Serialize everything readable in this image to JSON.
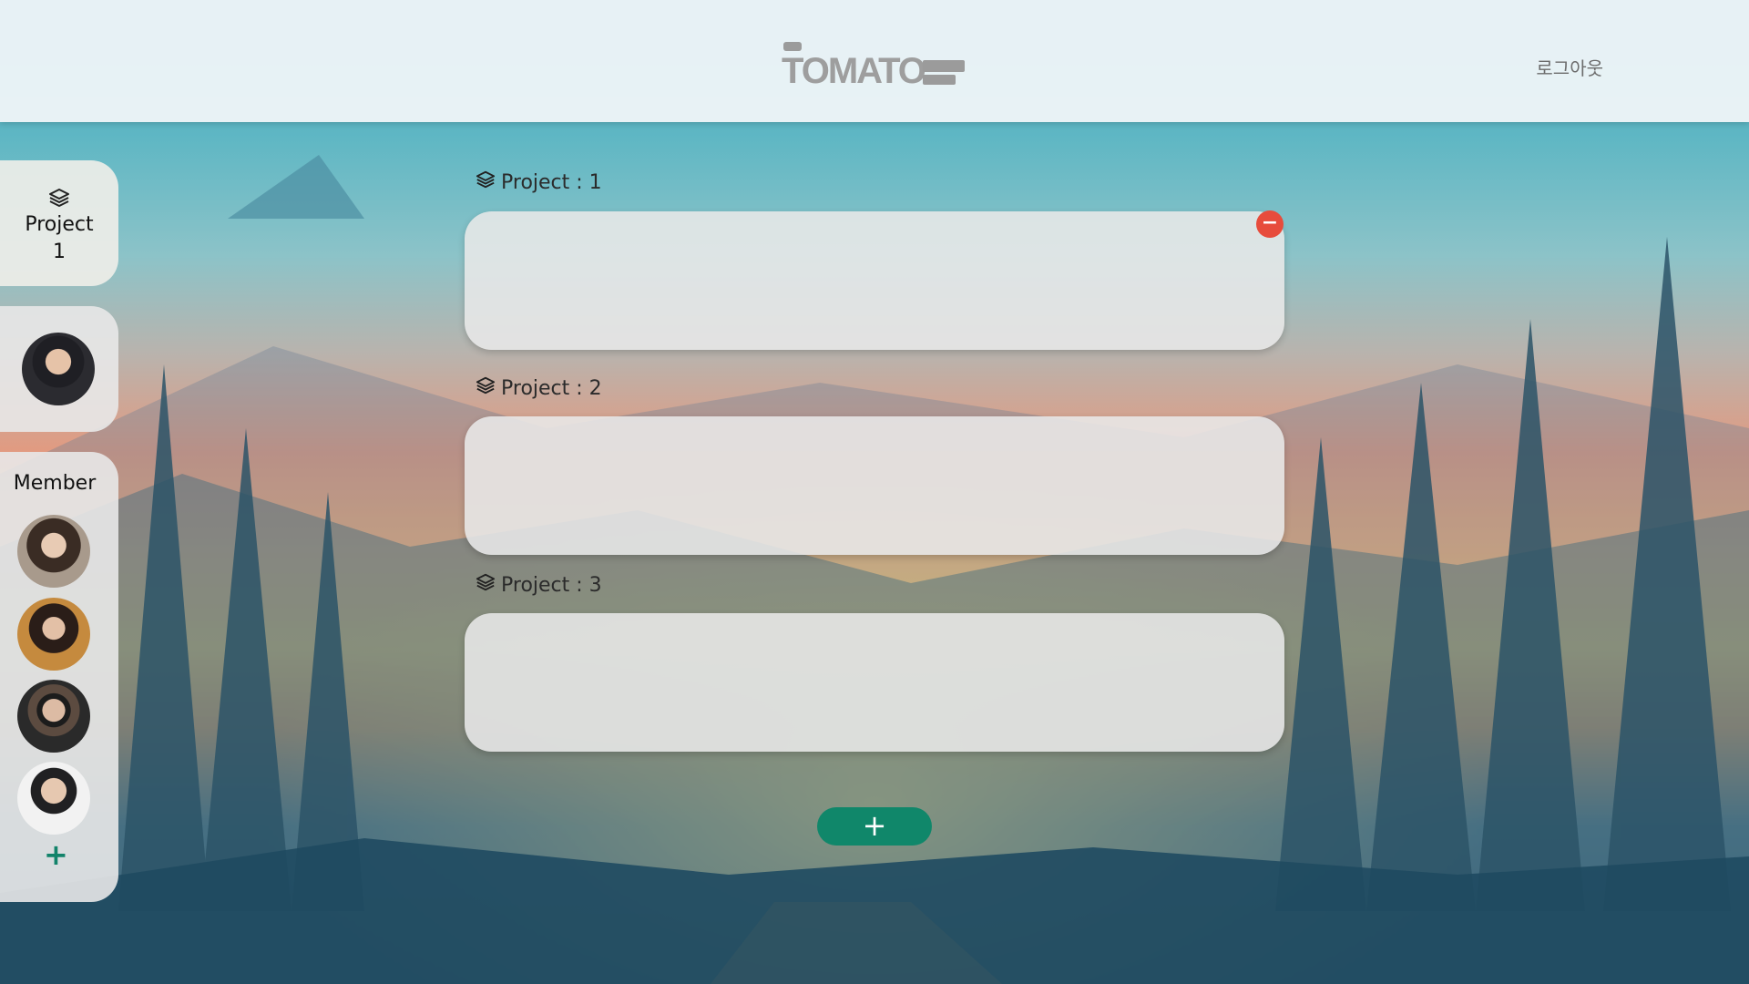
{
  "header": {
    "logo_text": "TOMATO",
    "logout_label": "로그아웃"
  },
  "sidebar": {
    "project_label": "Project",
    "project_number": "1",
    "members_title": "Member",
    "add_member_label": "+"
  },
  "projects": [
    {
      "label": "Project : 1"
    },
    {
      "label": "Project : 2"
    },
    {
      "label": "Project : 3"
    }
  ],
  "remove_label": "−",
  "add_project_label": "+",
  "colors": {
    "accent_green": "#10876a",
    "remove_red": "#e74c3c"
  },
  "icons": [
    "layers-icon",
    "minus-icon",
    "plus-icon"
  ]
}
